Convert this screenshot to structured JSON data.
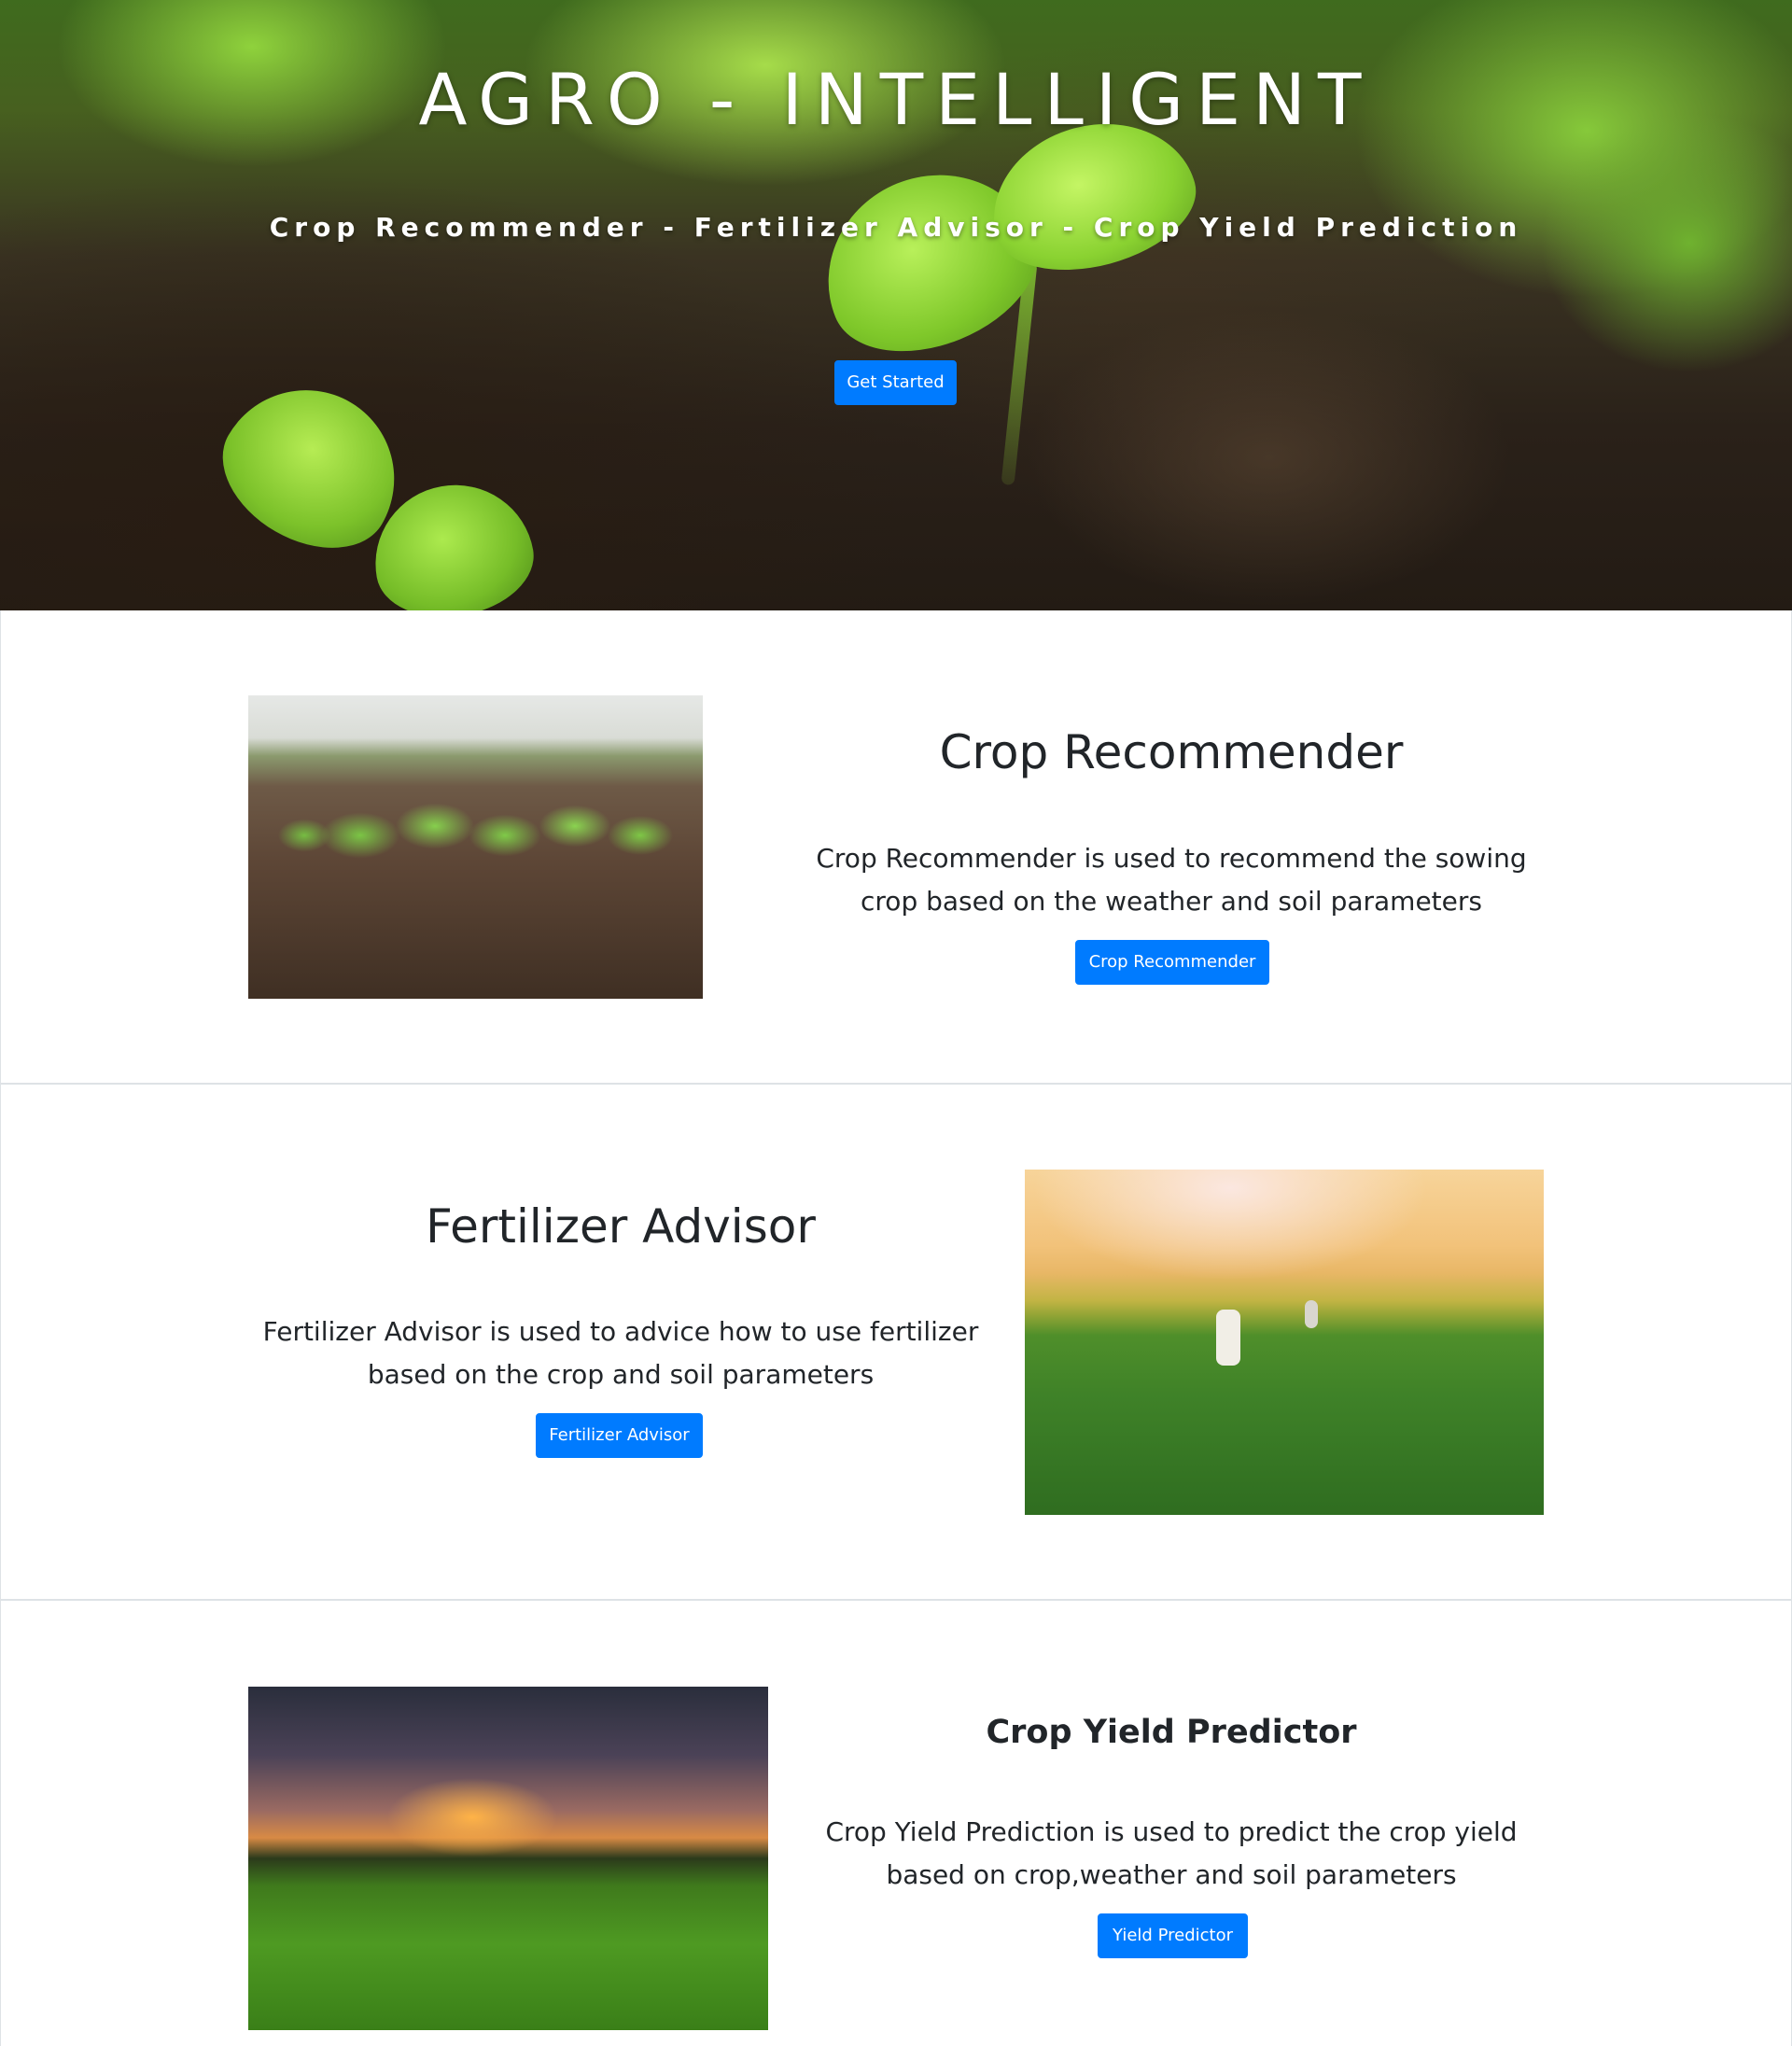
{
  "hero": {
    "title": "AGRO - INTELLIGENT",
    "subtitle": "Crop Recommender - Fertilizer Advisor - Crop Yield Prediction",
    "button_label": "Get Started"
  },
  "features": [
    {
      "title": "Crop Recommender",
      "description": "Crop Recommender is used to recommend the sowing crop based on the weather and soil parameters",
      "button_label": "Crop Recommender"
    },
    {
      "title": "Fertilizer Advisor",
      "description": "Fertilizer Advisor is used to advice how to use fertilizer based on the crop and soil parameters",
      "button_label": "Fertilizer Advisor"
    },
    {
      "title": "Crop Yield Predictor",
      "description": "Crop Yield Prediction is used to predict the crop yield based on crop,weather and soil parameters",
      "button_label": "Yield Predictor"
    }
  ],
  "colors": {
    "primary_button": "#007bff",
    "text": "#212529",
    "divider": "#dee2e6"
  }
}
